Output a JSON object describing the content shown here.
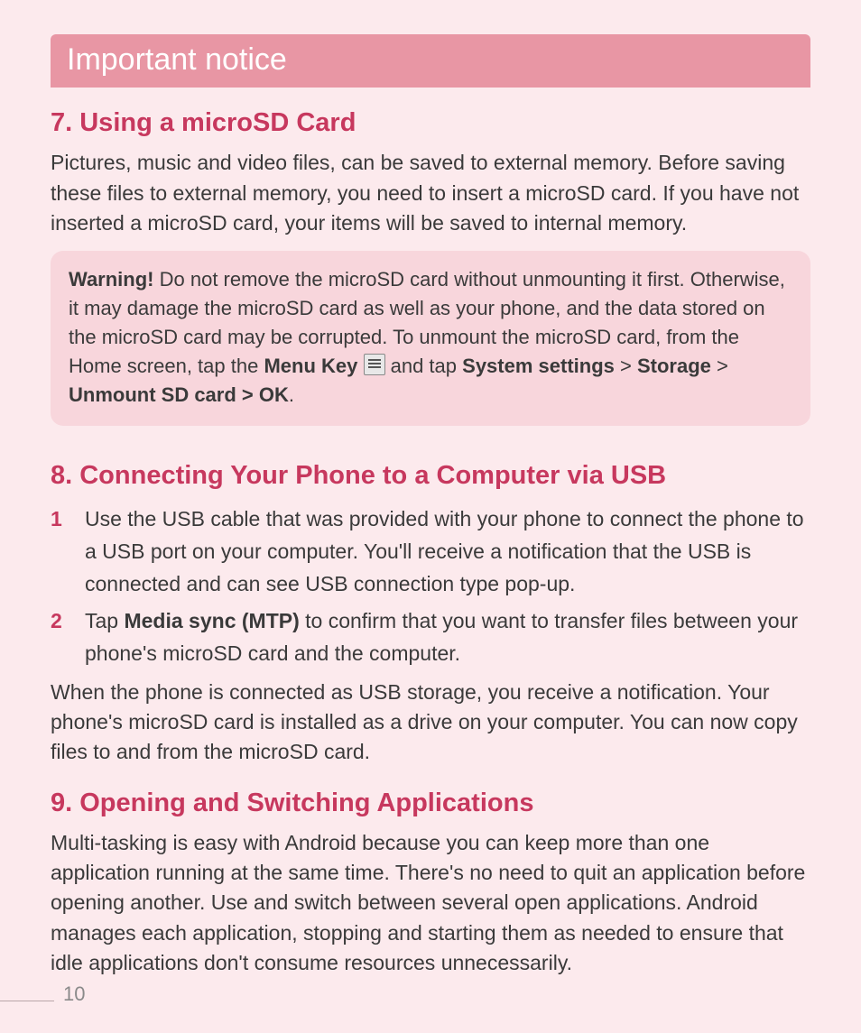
{
  "banner": {
    "title": "Important notice"
  },
  "section7": {
    "heading": "7. Using a microSD Card",
    "body": "Pictures, music and video files, can be saved to external memory. Before saving these files to external memory, you need to insert a microSD card. If you have not inserted a microSD card, your items will be saved to internal memory.",
    "warning": {
      "label": "Warning!",
      "part1": " Do not remove the microSD card without unmounting it first. Otherwise, it may damage the microSD card as well as your phone, and the data stored on the microSD card may be corrupted. To unmount the microSD card, from the Home screen, tap the ",
      "menu_key": "Menu Key",
      "part2": " and tap ",
      "system_settings": "System settings",
      "gt1": " > ",
      "storage": "Storage",
      "gt2": " > ",
      "unmount": "Unmount SD card > OK",
      "period": "."
    }
  },
  "section8": {
    "heading": "8. Connecting Your Phone to a Computer via USB",
    "steps": [
      {
        "pre": "Use the USB cable that was provided with your phone to connect the phone to a USB port on your computer. You'll receive a notification that the USB is connected and can see USB connection type pop-up."
      },
      {
        "pre": "Tap ",
        "bold": "Media sync (MTP)",
        "post": " to confirm that you want to transfer files between your phone's microSD card and the computer."
      }
    ],
    "after": "When the phone is connected as USB storage, you receive a notification. Your phone's microSD card is installed as a drive on your computer. You can now copy files to and from the microSD card."
  },
  "section9": {
    "heading": "9. Opening and Switching Applications",
    "body": "Multi-tasking is easy with Android because you can keep more than one application running at the same time. There's no need to quit an application before opening another. Use and switch between several open applications. Android manages each application, stopping and starting them as needed to ensure that idle applications don't consume resources unnecessarily."
  },
  "page_number": "10"
}
